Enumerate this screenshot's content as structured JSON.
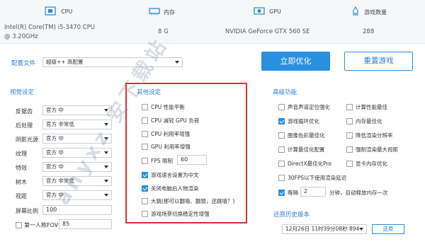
{
  "hardware": {
    "cpu": {
      "label": "CPU",
      "value_line1": "Intel(R) Core(TM) i5-3470 CPU",
      "value_line2": "@ 3.20GHz"
    },
    "memory": {
      "label": "内存",
      "value": "8 G"
    },
    "gpu": {
      "label": "GPU",
      "value": "NVIDIA GeForce GTX 560 SE"
    },
    "games": {
      "label": "游戏数量",
      "value": "288"
    }
  },
  "config": {
    "label": "配置文件",
    "selected": "超级++ 高配置",
    "optimize_button": "立即优化",
    "reset_button": "重置游戏"
  },
  "view_settings": {
    "title": "视觉设定",
    "rows": [
      {
        "label": "反锯齿",
        "value": "官方 中"
      },
      {
        "label": "后处理",
        "value": "官方 非常低"
      },
      {
        "label": "阴影光源",
        "value": "官方 中"
      },
      {
        "label": "纹理",
        "value": "官方 中"
      },
      {
        "label": "特效",
        "value": "官方 中"
      },
      {
        "label": "树木",
        "value": "官方 非常低"
      },
      {
        "label": "视距",
        "value": "官方 中"
      }
    ],
    "ratio_label": "屏幕比例",
    "ratio_value": "100",
    "fov_label": "第一人称FOV",
    "fov_value": "85"
  },
  "other_settings": {
    "title": "其他设定",
    "items": [
      {
        "label": "CPU 性能平衡",
        "checked": false
      },
      {
        "label": "CPU 减轻 GPU 负荷",
        "checked": false
      },
      {
        "label": "CPU 利用率增强",
        "checked": false
      },
      {
        "label": "GPU 利用率增强",
        "checked": false
      }
    ],
    "fps_label": "FPS 限制",
    "fps_value": "60",
    "items2": [
      {
        "label": "游戏语言设置为中文",
        "checked": true
      },
      {
        "label": "关闭电脑后人物渲染",
        "checked": true
      },
      {
        "label": "大跳(那可以翻墙、翻窗，还跳墙？)",
        "checked": false
      },
      {
        "label": "游戏场景切换稳定性增强",
        "checked": false
      }
    ]
  },
  "advanced": {
    "title": "高级功能",
    "left": [
      {
        "label": "声音声道定位强化",
        "checked": false
      },
      {
        "label": "游戏循环优化",
        "checked": true
      },
      {
        "label": "图像色彩最佳化",
        "checked": false
      },
      {
        "label": "计算最佳化配置",
        "checked": false
      },
      {
        "label": "DirectX最佳化Pro",
        "checked": false
      },
      {
        "label": "30FPS以下使用渲染延迟",
        "checked": false
      }
    ],
    "right": [
      {
        "label": "计算性能最佳",
        "checked": false
      },
      {
        "label": "内存最佳化",
        "checked": false
      },
      {
        "label": "降低渲染分辨率",
        "checked": false
      },
      {
        "label": "强制渲染最大视距",
        "checked": false
      },
      {
        "label": "显卡内存优化",
        "checked": false
      }
    ],
    "every_label": "每隔",
    "every_value": "2",
    "every_suffix": "分钟，自动释放内存一次",
    "every_checked": true
  },
  "restore": {
    "title": "还原历史版本",
    "selected": "12月26日 11时39分08秒 894",
    "button": "还原"
  },
  "watermark": "anyxz 安下载站",
  "colors": {
    "accent": "#2b8fe0",
    "highlight_box": "#e03030"
  }
}
